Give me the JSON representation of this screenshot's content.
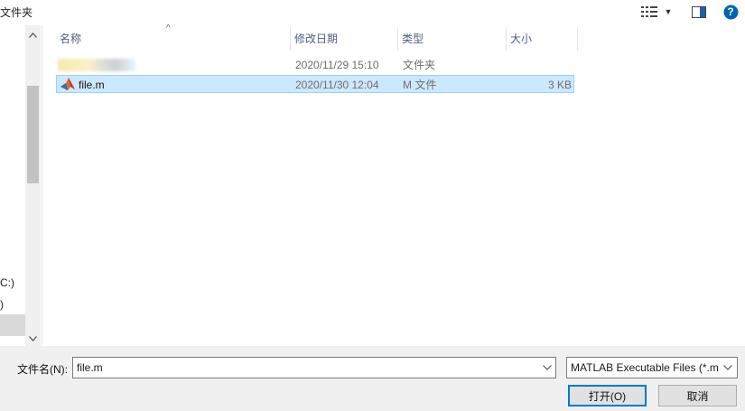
{
  "toolbar": {
    "location_label": "文件夹",
    "view_icon": "details-view-icon",
    "preview_icon": "preview-pane-icon",
    "help_icon": "help-icon",
    "help_glyph": "?"
  },
  "nav": {
    "items": [
      {
        "label": "C:)"
      },
      {
        "label": ")"
      }
    ]
  },
  "columns": {
    "name": "名称",
    "date": "修改日期",
    "type": "类型",
    "size": "大小"
  },
  "files": [
    {
      "name": "",
      "date": "2020/11/29 15:10",
      "type": "文件夹",
      "size": "",
      "selected": false
    },
    {
      "name": "file.m",
      "date": "2020/11/30 12:04",
      "type": "M 文件",
      "size": "3 KB",
      "selected": true
    }
  ],
  "bottom": {
    "filename_label": "文件名(N):",
    "filename_value": "file.m",
    "filetype_value": "MATLAB Executable Files (*.m",
    "open_label": "打开(O)",
    "cancel_label": "取消"
  },
  "colors": {
    "selection_bg": "#cce8ff",
    "selection_border": "#99d1ff",
    "primary_border": "#0078d7",
    "help_blue": "#0063b1"
  }
}
